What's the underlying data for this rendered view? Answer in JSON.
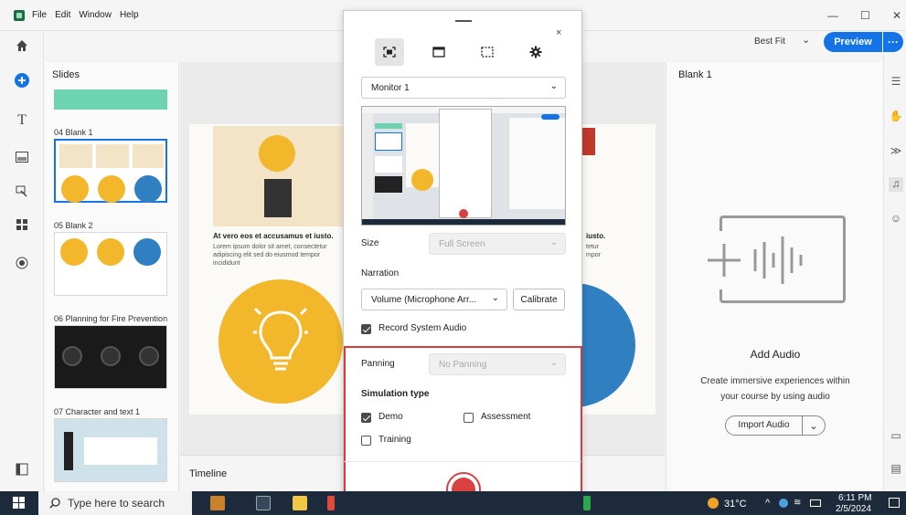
{
  "titlebar": {
    "menus": [
      "File",
      "Edit",
      "Window",
      "Help"
    ],
    "minimize": "—",
    "maximize": "☐",
    "close": "✕"
  },
  "toolbar": {
    "zoom": "Best Fit",
    "preview_label": "Preview",
    "more_label": "···"
  },
  "slides_panel": {
    "title": "Slides",
    "items": [
      {
        "label": "04 Blank 1"
      },
      {
        "label": "05 Blank 2"
      },
      {
        "label": "06 Planning for Fire Prevention"
      },
      {
        "label": "07 Character and text 1"
      }
    ]
  },
  "slide": {
    "heading": "At vero eos et accusamus et iusto.",
    "body": "Lorem ipsum dolor sit amet, consectetur adipiscing elit sed do eiusmod tempor incididunt",
    "right_heading": "iusto.",
    "right_body_lines": [
      "tetur",
      "mpor"
    ]
  },
  "timeline": {
    "label": "Timeline"
  },
  "right_panel": {
    "title": "Blank 1",
    "add_audio_title": "Add Audio",
    "description_line1": "Create immersive experiences within",
    "description_line2": "your course by using audio",
    "import_label": "Import Audio",
    "import_chevron": "⌄"
  },
  "dialog": {
    "close": "×",
    "monitor": "Monitor 1",
    "size_label": "Size",
    "size_value": "Full Screen",
    "narration_label": "Narration",
    "narration_value": "Volume (Microphone Arr...",
    "calibrate_label": "Calibrate",
    "record_audio_label": "Record System Audio",
    "panning_label": "Panning",
    "panning_value": "No Panning",
    "simulation_label": "Simulation type",
    "demo_label": "Demo",
    "assessment_label": "Assessment",
    "training_label": "Training",
    "chevron": "⌄"
  },
  "taskbar": {
    "search_placeholder": "Type here to search",
    "temperature": "31°C",
    "time": "6:11 PM",
    "date": "2/5/2024"
  },
  "colors": {
    "accent": "#1473e6",
    "record": "#d94040",
    "highlight_border": "#d93a3a",
    "yellow": "#f2b72a",
    "blue": "#2f7fc1"
  }
}
